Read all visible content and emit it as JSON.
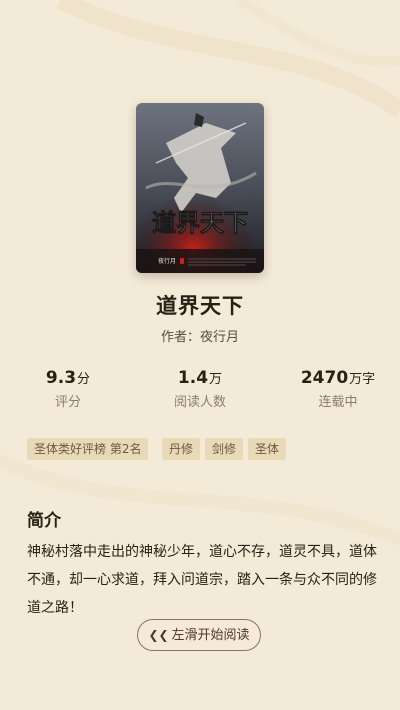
{
  "book": {
    "title": "道界天下",
    "author_line": "作者：夜行月",
    "cover": {
      "title_art": "道界天下",
      "author_small": "夜行月"
    }
  },
  "stats": [
    {
      "value": "9.3",
      "unit": "分",
      "label": "评分"
    },
    {
      "value": "1.4",
      "unit": "万",
      "label": "阅读人数"
    },
    {
      "value": "2470",
      "unit": "万字",
      "label": "连载中"
    }
  ],
  "tags": [
    "圣体类好评榜 第2名",
    "丹修",
    "剑修",
    "圣体"
  ],
  "intro": {
    "heading": "简介",
    "text": "神秘村落中走出的神秘少年，道心不存，道灵不具，道体不通，却一心求道，拜入问道宗，踏入一条与众不同的修道之路！"
  },
  "start_button": {
    "icon": "double-chevron-left-icon",
    "label": "左滑开始阅读"
  },
  "colors": {
    "background": "#f4ead8",
    "tag_bg": "#e8d9b8",
    "tag_text": "#6f5a3c"
  }
}
